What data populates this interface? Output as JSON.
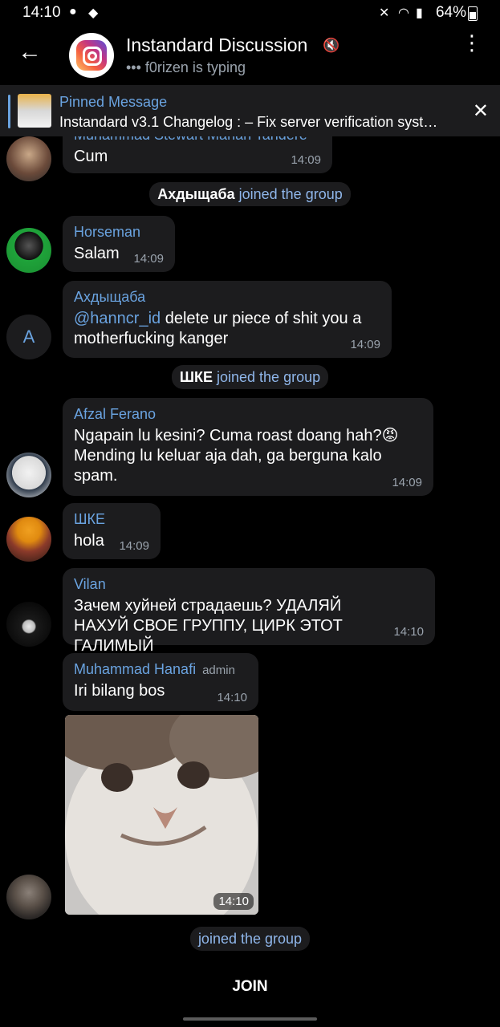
{
  "status_bar": {
    "time": "14:10",
    "battery": "64%",
    "icons": [
      "spotify-icon",
      "cat-icon",
      "mute-icon",
      "wifi-icon",
      "signal-icon",
      "battery-icon"
    ]
  },
  "header": {
    "title": "Instandard Discussion",
    "subtitle": "••• f0rizen is typing",
    "back_icon": "←",
    "menu_icon": "⋮",
    "muted_icon": "🔇"
  },
  "pinned": {
    "label": "Pinned Message",
    "text": "Instandard v3.1 Changelog :  – Fix server verification syst…",
    "close": "✕"
  },
  "messages": [
    {
      "sender": "Muhammad Stewart Mahan Tahdere",
      "text": "Cum",
      "time": "14:09"
    },
    {
      "type": "service",
      "name": "Ахдыщаба",
      "action": "joined the group"
    },
    {
      "sender": "Horseman",
      "text": "Salam",
      "time": "14:09"
    },
    {
      "sender": "Ахдыщаба",
      "mention": "@hanncr_id",
      "text": "delete ur piece of shit you a motherfucking kanger",
      "time": "14:09",
      "avatar_letter": "A"
    },
    {
      "type": "service",
      "name": "ШКЕ",
      "action": "joined the group"
    },
    {
      "sender": "Afzal Ferano",
      "text": "Ngapain lu kesini? Cuma roast doang hah?😡 Mending lu keluar aja dah, ga berguna kalo spam.",
      "time": "14:09"
    },
    {
      "sender": "ШКЕ",
      "text": "hola",
      "time": "14:09"
    },
    {
      "sender": "Vilan",
      "text": "Зачем хуйней страдаешь? УДАЛЯЙ НАХУЙ СВОЕ ГРУППУ, ЦИРК ЭТОТ ГАЛИМЫЙ",
      "time": "14:10"
    },
    {
      "sender": "Muhammad Hanafi",
      "badge": "admin",
      "text": "Iri bilang bos",
      "time": "14:10",
      "photo_time": "14:10"
    },
    {
      "type": "service",
      "name": "",
      "action": "joined the group"
    }
  ],
  "footer": {
    "join_label": "JOIN"
  },
  "colors": {
    "background": "#000000",
    "bubble": "#1c1c1e",
    "accent": "#6aa3e0"
  }
}
